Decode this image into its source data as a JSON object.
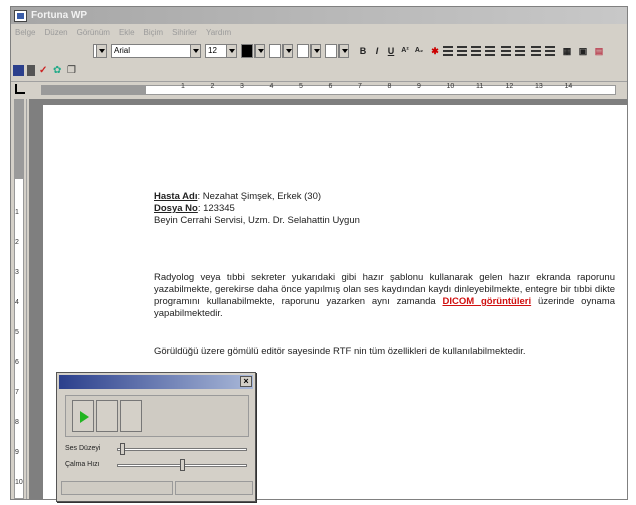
{
  "window": {
    "title": "Fortuna WP"
  },
  "menu": [
    "Belge",
    "Düzen",
    "Görünüm",
    "Ekle",
    "Biçim",
    "Sihirler",
    "Yardım"
  ],
  "toolbar": {
    "font_name": "Arial",
    "font_size": "12",
    "buttons": [
      {
        "name": "bold-button",
        "glyph": "B"
      },
      {
        "name": "italic-button",
        "glyph": "I"
      },
      {
        "name": "underline-button",
        "glyph": "U"
      },
      {
        "name": "superscript-button",
        "glyph": "A²"
      },
      {
        "name": "subscript-button",
        "glyph": "A₂"
      }
    ],
    "icons": [
      "save-icon",
      "delete-icon",
      "spell-check-icon",
      "insert-image-icon",
      "copy-icon"
    ]
  },
  "ruler": {
    "h_ticks": [
      "1",
      "2",
      "3",
      "4",
      "5",
      "6",
      "7",
      "8",
      "9",
      "10",
      "11",
      "12",
      "13",
      "14"
    ],
    "v_ticks": [
      "1",
      "2",
      "3",
      "4",
      "5",
      "6",
      "7",
      "8",
      "9",
      "10"
    ]
  },
  "document": {
    "patient_label": "Hasta Adı",
    "patient_value": ": Nezahat Şimşek, Erkek (30)",
    "file_label": "Dosya No",
    "file_value": ": 123345",
    "department": "Beyin Cerrahi Servisi, Uzm. Dr. Selahattin Uygun",
    "para1_a": "Radyolog veya tıbbi sekreter yukarıdaki gibi hazır şablonu kullanarak gelen hazır ekranda raporunu yazabilmekte, gerekirse daha önce yapılmış olan ses kaydından kaydı dinleyebilmekte, entegre bir tıbbi dikte programını kullanabilmekte, raporunu yazarken aynı zamanda",
    "para1_link": "DICOM görüntüleri",
    "para1_b": "üzerinde oynama yapabilmektedir.",
    "para2": "Görüldüğü üzere gömülü editör sayesinde RTF nin tüm özellikleri de kullanılabilmektedir."
  },
  "player": {
    "volume_label": "Ses Düzeyi",
    "speed_label": "Çalma Hızı",
    "close_glyph": "×",
    "volume_level": 0.02,
    "speed_level": 0.5
  }
}
